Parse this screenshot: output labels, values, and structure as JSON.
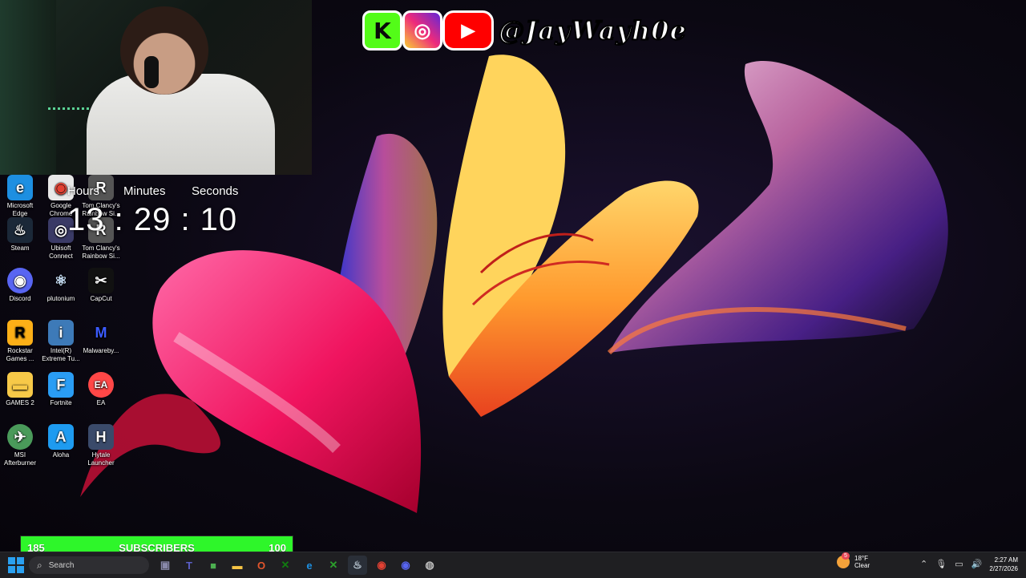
{
  "social": {
    "kick_glyph": "K",
    "instagram_glyph": "◎",
    "youtube_glyph": "▶",
    "handle": "@JayWayh0e"
  },
  "desktop_icons": [
    {
      "label": "Microsoft Edge",
      "glyph": "e",
      "color": "#1d8fe1"
    },
    {
      "label": "Google Chrome",
      "glyph": "◉",
      "color": "#e8e8e8"
    },
    {
      "label": "Tom Clancy's Rainbow Si...",
      "glyph": "R",
      "color": "#555555"
    },
    {
      "label": "Steam",
      "glyph": "♨",
      "color": "#1b2838"
    },
    {
      "label": "Ubisoft Connect",
      "glyph": "◎",
      "color": "#3a3a66"
    },
    {
      "label": "Tom Clancy's Rainbow Si...",
      "glyph": "R",
      "color": "#555555"
    },
    {
      "label": "Discord",
      "glyph": "◉",
      "color": "#5865f2"
    },
    {
      "label": "plutonium",
      "glyph": "⚛",
      "color": "#26303a"
    },
    {
      "label": "CapCut",
      "glyph": "✂",
      "color": "#111111"
    },
    {
      "label": "Rockstar Games ...",
      "glyph": "R",
      "color": "#fcaf17"
    },
    {
      "label": "Intel(R) Extreme Tu...",
      "glyph": "i",
      "color": "#3d7ab8"
    },
    {
      "label": "Malwareby...",
      "glyph": "M",
      "color": "#1a2a7a"
    },
    {
      "label": "GAMES 2",
      "glyph": "▬",
      "color": "#f7c948"
    },
    {
      "label": "Fortnite",
      "glyph": "F",
      "color": "#2a9df4"
    },
    {
      "label": "EA",
      "glyph": "EA",
      "color": "#ff4747"
    },
    {
      "label": "MSI Afterburner",
      "glyph": "✈",
      "color": "#4a9a5a"
    },
    {
      "label": "Aloha",
      "glyph": "A",
      "color": "#1e9bf0"
    },
    {
      "label": "Hytale Launcher",
      "glyph": "H",
      "color": "#3a4a6a"
    }
  ],
  "timer": {
    "hours_label": "Hours",
    "minutes_label": "Minutes",
    "seconds_label": "Seconds",
    "value": "13 : 29 : 10"
  },
  "subscribers": {
    "current": "185",
    "label": "SUBSCRIBERS",
    "goal": "100",
    "fill_fraction": 1.0
  },
  "taskbar": {
    "search_placeholder": "Search",
    "apps": [
      {
        "name": "file-manager",
        "glyph": "▣",
        "color": "#8888aa"
      },
      {
        "name": "teams",
        "glyph": "T",
        "color": "#5b5fc7"
      },
      {
        "name": "minecraft",
        "glyph": "■",
        "color": "#4caf50"
      },
      {
        "name": "file-explorer",
        "glyph": "▬",
        "color": "#f6c445"
      },
      {
        "name": "office",
        "glyph": "O",
        "color": "#e3552c"
      },
      {
        "name": "xbox-app",
        "glyph": "✕",
        "color": "#107c10"
      },
      {
        "name": "edge",
        "glyph": "e",
        "color": "#1d8fe1"
      },
      {
        "name": "xbox",
        "glyph": "✕",
        "color": "#2ca02c"
      },
      {
        "name": "steam",
        "glyph": "♨",
        "color": "#1b2838"
      },
      {
        "name": "chrome",
        "glyph": "◉",
        "color": "#e34133"
      },
      {
        "name": "discord",
        "glyph": "◉",
        "color": "#5865f2"
      },
      {
        "name": "obs",
        "glyph": "◍",
        "color": "#333333"
      }
    ],
    "weather": {
      "temp": "18°F",
      "condition": "Clear",
      "badge": "5"
    },
    "time": "2:27 AM",
    "date": "2/27/2026"
  }
}
